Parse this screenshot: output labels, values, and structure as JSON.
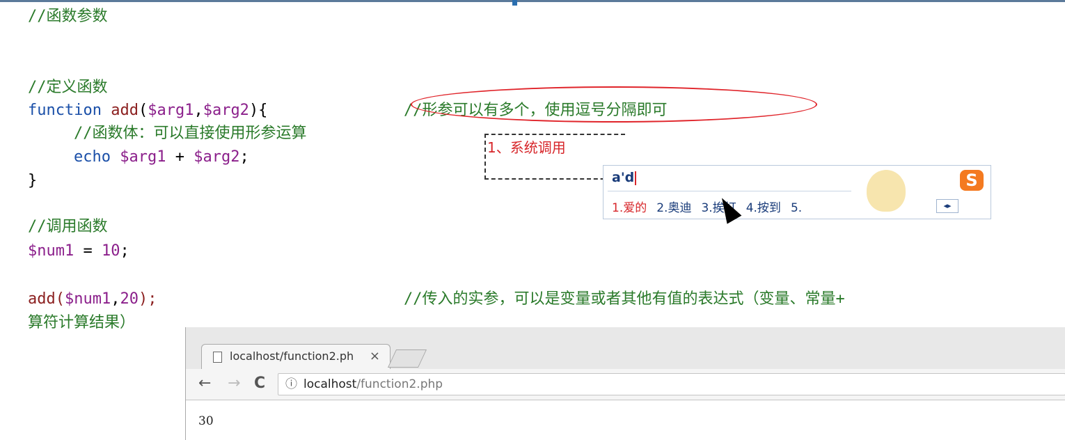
{
  "code": {
    "line1": "//函数参数",
    "line2": "//定义函数",
    "line3_kw": "function",
    "line3_name": "add",
    "line3_params_open": "(",
    "line3_arg1": "$arg1",
    "line3_comma": ",",
    "line3_arg2": "$arg2",
    "line3_close": "){",
    "line3_comment": "//形参可以有多个，使用逗号分隔即可",
    "line4": "//函数体：可以直接使用形参运算",
    "line5_echo": "echo",
    "line5_a": "$arg1",
    "line5_plus": " + ",
    "line5_b": "$arg2",
    "line5_end": ";",
    "line6": "}",
    "line7": "//调用函数",
    "line8_var": "$num1",
    "line8_eq": " = ",
    "line8_val": "10",
    "line8_end": ";",
    "line9_fn": "add(",
    "line9_var": "$num1",
    "line9_comma": ",",
    "line9_val": "20",
    "line9_end": ");",
    "line9_comment": "//传入的实参，可以是变量或者其他有值的表达式（变量、常量+",
    "line10": "算符计算结果）"
  },
  "annotation": {
    "text": "1、系统调用"
  },
  "ime": {
    "input": "a'd",
    "candidates": [
      "1.爱的",
      "2.奥迪",
      "3.挨打",
      "4.按到",
      "5."
    ],
    "logo": "S",
    "arrows": "◂▸"
  },
  "browser": {
    "tab_title": "localhost/function2.ph",
    "tab_close": "×",
    "nav_back": "←",
    "nav_forward": "→",
    "nav_reload": "C",
    "info_icon": "ⓘ",
    "url_host": "localhost",
    "url_path": "/function2.php",
    "output": "30"
  }
}
